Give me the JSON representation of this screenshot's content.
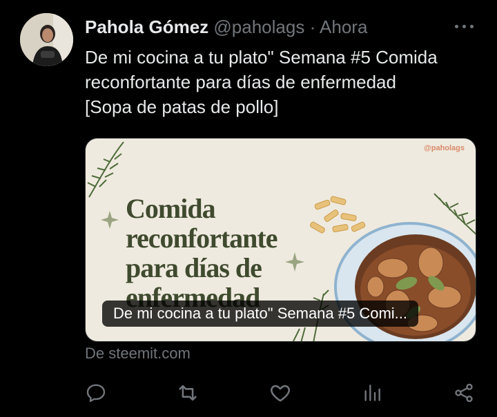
{
  "author": {
    "name": "Pahola Gómez",
    "handle": "@paholags",
    "separator": "·",
    "time": "Ahora",
    "avatar_icon": "profile-photo-icon"
  },
  "tweet": {
    "lines": [
      "De mi cocina a tu plato\" Semana #5 Comida",
      "reconfortante para días de enfermedad",
      "[Sopa de patas de pollo]"
    ]
  },
  "card": {
    "image_handle": "@paholags",
    "headline": [
      "Comida",
      "reconfortante",
      "para días de",
      "enfermedad"
    ],
    "caption": "De mi cocina a tu plato\" Semana #5 Comi...",
    "source": "De steemit.com"
  },
  "actions": [
    {
      "name": "reply",
      "icon": "reply-icon"
    },
    {
      "name": "retweet",
      "icon": "retweet-icon"
    },
    {
      "name": "like",
      "icon": "like-icon"
    },
    {
      "name": "views",
      "icon": "views-icon"
    },
    {
      "name": "share",
      "icon": "share-icon"
    }
  ],
  "colors": {
    "background": "#000000",
    "text": "#e7e9ea",
    "secondary": "#71767b",
    "headline": "#3f4a2e",
    "card_bg": "#efeadf"
  }
}
